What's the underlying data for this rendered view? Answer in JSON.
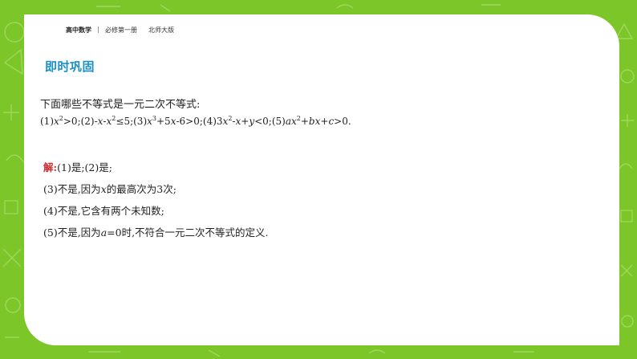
{
  "header": {
    "subject": "高中数学",
    "book": "必修第一册",
    "publisher": "北师大版"
  },
  "section_title": "即时巩固",
  "question": {
    "text": "下面哪些不等式是一元二次不等式:",
    "formula": {
      "p1": "(1)",
      "p2": "x",
      "p3": "2",
      "p4": ">0;(2)-",
      "p5": "x",
      "p6": "-",
      "p7": "x",
      "p8": "2",
      "p9": "≤5;(3)",
      "p10": "x",
      "p11": "3",
      "p12": "+5",
      "p13": "x",
      "p14": "-6>0;(4)3",
      "p15": "x",
      "p16": "2",
      "p17": "-",
      "p18": "x",
      "p19": "+",
      "p20": "y",
      "p21": "<0;(5)",
      "p22": "ax",
      "p23": "2",
      "p24": "+",
      "p25": "bx",
      "p26": "+",
      "p27": "c",
      "p28": ">0."
    }
  },
  "answer": {
    "label": "解:",
    "line1": "(1)是;(2)是;",
    "line2_a": "(3)不是,因为",
    "line2_var": "x",
    "line2_b": "的最高次为3次;",
    "line3": "(4)不是,它含有两个未知数;",
    "line4_a": "(5)不是,因为",
    "line4_var": "a",
    "line4_b": "=0时,不符合一元二次不等式的定义."
  },
  "colors": {
    "background": "#7dc62a",
    "title": "#1a8fc7",
    "answer_label": "#d62b2b"
  }
}
